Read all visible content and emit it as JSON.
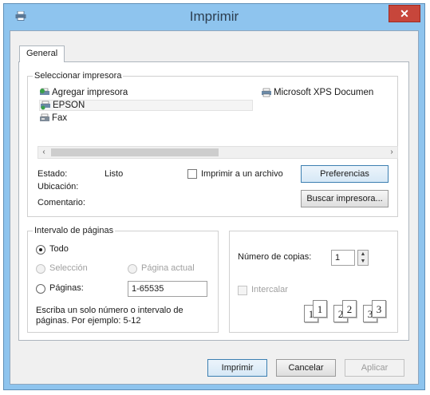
{
  "window": {
    "title": "Imprimir",
    "close_glyph": "✕"
  },
  "tabs": [
    {
      "label": "General"
    }
  ],
  "printer_select": {
    "group_label": "Seleccionar impresora",
    "printers": [
      {
        "name": "Agregar impresora",
        "icon": "add-printer-icon"
      },
      {
        "name": "Microsoft XPS Documen",
        "icon": "printer-icon"
      },
      {
        "name": "EPSON",
        "icon": "printer-icon",
        "selected": true
      },
      {
        "name": "Fax",
        "icon": "fax-icon"
      }
    ],
    "scroll_left": "‹",
    "scroll_right": "›",
    "status_label": "Estado:",
    "status_value": "Listo",
    "location_label": "Ubicación:",
    "comment_label": "Comentario:",
    "print_to_file_label": "Imprimir a un archivo",
    "preferences_label": "Preferencias",
    "find_printer_label": "Buscar impresora..."
  },
  "page_range": {
    "group_label": "Intervalo de páginas",
    "all_label": "Todo",
    "selection_label": "Selección",
    "current_page_label": "Página actual",
    "pages_label": "Páginas:",
    "pages_value": "1-65535",
    "hint_line1": "Escriba un solo número o intervalo de",
    "hint_line2": "páginas. Por ejemplo: 5-12"
  },
  "copies": {
    "copies_label": "Número de copias:",
    "copies_value": "1",
    "collate_label": "Intercalar",
    "collate_pages": [
      "1",
      "1",
      "2",
      "2",
      "3",
      "3"
    ]
  },
  "buttons": {
    "print": "Imprimir",
    "cancel": "Cancelar",
    "apply": "Aplicar"
  }
}
